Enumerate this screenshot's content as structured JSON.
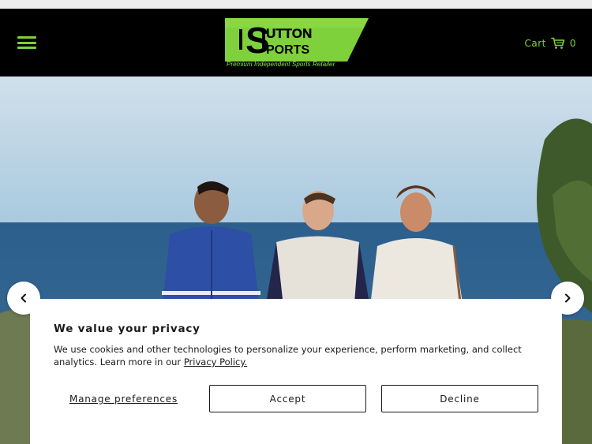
{
  "header": {
    "menu_icon": "hamburger-menu-icon",
    "logo": {
      "word_top": "UTTON",
      "word_bottom": "PORTS",
      "monogram": "S",
      "tagline": "Premium Independent Sports Retailer"
    },
    "cart": {
      "label": "Cart",
      "icon": "shopping-cart-icon",
      "count": "0"
    }
  },
  "hero": {
    "prev_icon": "chevron-left-icon",
    "next_icon": "chevron-right-icon"
  },
  "cookie_banner": {
    "title": "We value your privacy",
    "text": "We use cookies and other technologies to personalize your experience, perform marketing, and collect analytics. Learn more in our ",
    "link": "Privacy Policy.",
    "manage_label": "Manage preferences",
    "accept_label": "Accept",
    "decline_label": "Decline"
  },
  "colors": {
    "brand_green": "#7fd13b",
    "header_bg": "#000000"
  }
}
